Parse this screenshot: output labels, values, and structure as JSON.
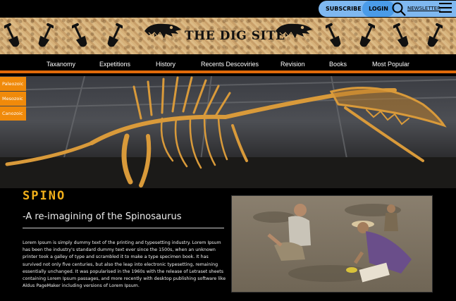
{
  "topbar": {
    "subscribe_label": "SUBSCRIBE",
    "login_label": "LOGIN",
    "newsletter_label": "NEWSLETTER",
    "icons": [
      "search-icon",
      "menu-icon"
    ]
  },
  "banner": {
    "site_title": "THE DIG SITE",
    "icons": [
      "shovel-icon",
      "dino-skull-icon"
    ]
  },
  "nav": {
    "items": [
      {
        "label": "Taxanomy"
      },
      {
        "label": "Expetitions"
      },
      {
        "label": "History"
      },
      {
        "label": "Recents Descoviries"
      },
      {
        "label": "Revision"
      },
      {
        "label": "Books"
      },
      {
        "label": "Most Popular"
      }
    ]
  },
  "eras": [
    {
      "label": "Paleozoic"
    },
    {
      "label": "Mesozoic"
    },
    {
      "label": "Canozoic"
    }
  ],
  "article": {
    "heading": "SPINO",
    "subheading": "-A re-imagining of the Spinosaurus",
    "body": "Lorem Ipsum is simply dummy text of the printing and typesetting industry. Lorem Ipsum has been the industry's standard dummy text ever since the 1500s, when an unknown printer took a galley of type and scrambled it to make a type specimen book. It has survived not only five centuries, but also the leap into electronic typesetting, remaining essentially unchanged. It was popularised in the 1960s with the release of Letraset sheets containing Lorem Ipsum passages, and more recently with desktop publishing software like Aldus PageMaker including versions of Lorem Ipsum."
  },
  "colors": {
    "accent_orange": "#e06a0a",
    "heading_gold": "#f2b01a",
    "login_blue": "#4a9be8"
  }
}
